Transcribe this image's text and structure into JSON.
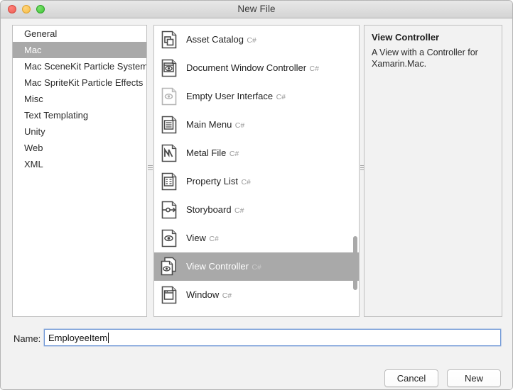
{
  "window": {
    "title": "New File",
    "traffic_lights": [
      "close-button",
      "minimize-button",
      "zoom-button"
    ]
  },
  "categories": {
    "items": [
      {
        "label": "General",
        "selected": false
      },
      {
        "label": "Mac",
        "selected": true
      },
      {
        "label": "Mac SceneKit Particle Systems",
        "selected": false
      },
      {
        "label": "Mac SpriteKit Particle Effects",
        "selected": false
      },
      {
        "label": "Misc",
        "selected": false
      },
      {
        "label": "Text Templating",
        "selected": false
      },
      {
        "label": "Unity",
        "selected": false
      },
      {
        "label": "Web",
        "selected": false
      },
      {
        "label": "XML",
        "selected": false
      }
    ]
  },
  "templates": {
    "items": [
      {
        "name": "Asset Catalog",
        "language": "C#",
        "icon": "asset-catalog-icon",
        "selected": false
      },
      {
        "name": "Document Window Controller",
        "language": "C#",
        "icon": "document-window-controller-icon",
        "selected": false
      },
      {
        "name": "Empty User Interface",
        "language": "C#",
        "icon": "empty-user-interface-icon",
        "selected": false
      },
      {
        "name": "Main Menu",
        "language": "C#",
        "icon": "main-menu-icon",
        "selected": false
      },
      {
        "name": "Metal File",
        "language": "C#",
        "icon": "metal-file-icon",
        "selected": false
      },
      {
        "name": "Property List",
        "language": "C#",
        "icon": "property-list-icon",
        "selected": false
      },
      {
        "name": "Storyboard",
        "language": "C#",
        "icon": "storyboard-icon",
        "selected": false
      },
      {
        "name": "View",
        "language": "C#",
        "icon": "view-icon",
        "selected": false
      },
      {
        "name": "View Controller",
        "language": "C#",
        "icon": "view-controller-icon",
        "selected": true
      },
      {
        "name": "Window",
        "language": "C#",
        "icon": "window-icon",
        "selected": false
      }
    ]
  },
  "detail": {
    "title": "View Controller",
    "description": "A View with a Controller for Xamarin.Mac."
  },
  "name_field": {
    "label": "Name:",
    "value": "EmployeeItem",
    "placeholder": ""
  },
  "buttons": {
    "cancel": "Cancel",
    "new": "New"
  },
  "colors": {
    "selection": "#a9a9a9",
    "window_background": "#f2f2f2",
    "focus_border": "#6f97d6"
  }
}
